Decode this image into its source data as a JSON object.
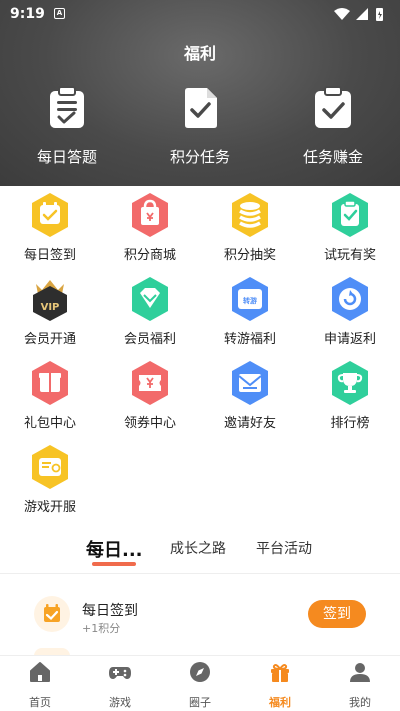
{
  "status_bar": {
    "time": "9:19",
    "notif_letter": "A"
  },
  "header": {
    "title": "福利",
    "items": [
      {
        "label": "每日答题",
        "icon": "quiz-clipboard-icon"
      },
      {
        "label": "积分任务",
        "icon": "task-document-icon"
      },
      {
        "label": "任务赚金",
        "icon": "earn-clipboard-icon"
      }
    ]
  },
  "grid": [
    {
      "label": "每日签到",
      "icon": "calendar-icon",
      "color": "#f7c325"
    },
    {
      "label": "积分商城",
      "icon": "shop-bag-icon",
      "color": "#f26a6a"
    },
    {
      "label": "积分抽奖",
      "icon": "coins-icon",
      "color": "#f7c325"
    },
    {
      "label": "试玩有奖",
      "icon": "trial-clipboard-icon",
      "color": "#2fcf9b"
    },
    {
      "label": "会员开通",
      "icon": "vip-badge-icon",
      "color": "#2e2e2e",
      "badge": "VIP"
    },
    {
      "label": "会员福利",
      "icon": "diamond-icon",
      "color": "#2fcf9b"
    },
    {
      "label": "转游福利",
      "icon": "transfer-game-icon",
      "color": "#4f8ef7",
      "badge": "转游"
    },
    {
      "label": "申请返利",
      "icon": "rebate-icon",
      "color": "#4f8ef7"
    },
    {
      "label": "礼包中心",
      "icon": "gift-box-icon",
      "color": "#f26a6a"
    },
    {
      "label": "领券中心",
      "icon": "coupon-icon",
      "color": "#f26a6a"
    },
    {
      "label": "邀请好友",
      "icon": "invite-mail-icon",
      "color": "#4f8ef7"
    },
    {
      "label": "排行榜",
      "icon": "trophy-icon",
      "color": "#2fcf9b"
    },
    {
      "label": "游戏开服",
      "icon": "server-open-icon",
      "color": "#f7c325"
    }
  ],
  "tabs": [
    {
      "label": "每日..."
    },
    {
      "label": "成长之路"
    },
    {
      "label": "平台活动"
    }
  ],
  "task": {
    "title": "每日签到",
    "reward": "+1积分",
    "button": "签到"
  },
  "bottom_nav": [
    {
      "label": "首页",
      "icon": "home-icon"
    },
    {
      "label": "游戏",
      "icon": "gamepad-icon"
    },
    {
      "label": "圈子",
      "icon": "compass-icon"
    },
    {
      "label": "福利",
      "icon": "gift-icon",
      "active": true
    },
    {
      "label": "我的",
      "icon": "user-icon"
    }
  ],
  "colors": {
    "accent": "#f58a1f",
    "tab_underline": "#f06b4c"
  }
}
